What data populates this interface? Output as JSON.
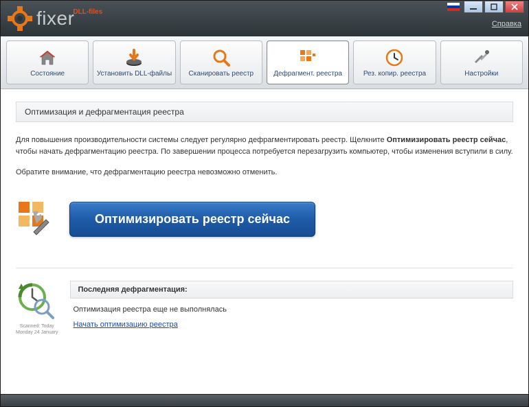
{
  "app": {
    "brand_prefix": "DLL-files",
    "brand_name": "fixer",
    "help_link": "Справка"
  },
  "tabs": {
    "state": "Состояние",
    "install": "Установить DLL-файлы",
    "scan": "Сканировать реестр",
    "defrag": "Дефрагмент. реестра",
    "backup": "Рез. копир. реестра",
    "settings": "Настройки"
  },
  "main": {
    "section_title": "Оптимизация и дефрагментация реестра",
    "para1_pre": "Для повышения производительности системы следует регулярно дефрагментировать реестр. Щелкните ",
    "para1_bold": "Оптимизировать реестр сейчас",
    "para1_post": ", чтобы начать дефрагментацию реестра. По завершении процесса потребуется перезагрузить компьютер, чтобы изменения вступили в силу.",
    "para2": "Обратите внимание, что дефрагментацию реестра невозможно отменить.",
    "optimize_button": "Оптимизировать реестр сейчас"
  },
  "status": {
    "caption_line1": "Scanned: Today",
    "caption_line2": "Monday 24 January",
    "header": "Последняя дефрагментация:",
    "text": "Оптимизация реестра еще не выполнялась",
    "link": "Начать оптимизацию реестра"
  },
  "colors": {
    "accent_orange": "#e67817",
    "accent_blue": "#1e5ba8"
  }
}
